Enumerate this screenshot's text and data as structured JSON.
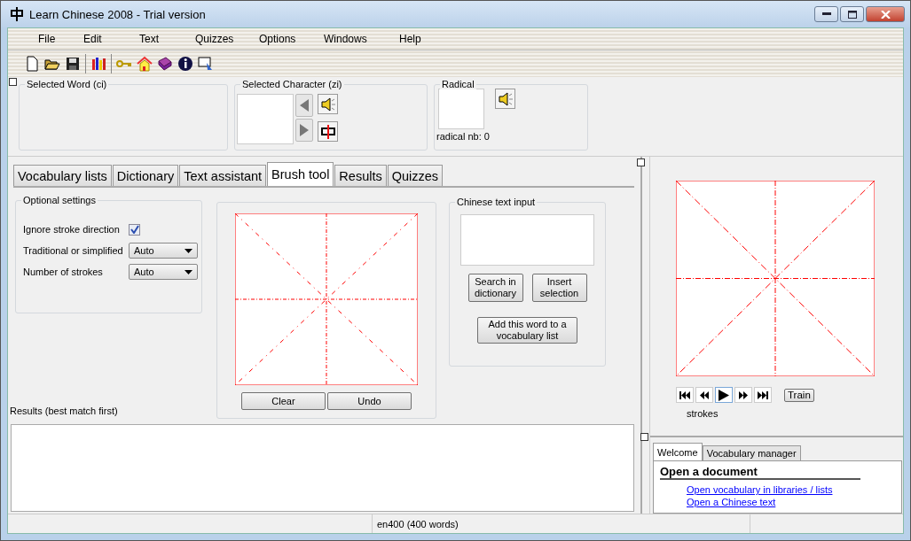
{
  "window": {
    "title": "Learn Chinese 2008 - Trial version"
  },
  "menu": [
    "File",
    "Edit",
    "Text",
    "Quizzes",
    "Options",
    "Windows",
    "Help"
  ],
  "info_panel": {
    "word_title": "Selected Word (ci)",
    "character_title": "Selected Character (zi)",
    "radical_title": "Radical",
    "radical_caption": "radical nb: 0"
  },
  "tabs": [
    {
      "label": "Vocabulary lists",
      "selected": false
    },
    {
      "label": "Dictionary",
      "selected": false
    },
    {
      "label": "Text assistant",
      "selected": false
    },
    {
      "label": "Brush tool",
      "selected": true
    },
    {
      "label": "Results",
      "selected": false
    },
    {
      "label": "Quizzes",
      "selected": false
    }
  ],
  "optional_settings": {
    "title": "Optional settings",
    "ignore_stroke_direction": {
      "label": "Ignore stroke direction",
      "checked": true
    },
    "script": {
      "label": "Traditional or simplified",
      "value": "Auto"
    },
    "strokes": {
      "label": "Number of strokes",
      "value": "Auto"
    }
  },
  "brush_buttons": [
    "Clear",
    "Undo"
  ],
  "text_input": {
    "title": "Chinese text input",
    "search_button": "Search in dictionary",
    "insert_button": "Insert selection",
    "add_button": "Add this word to a vocabulary list"
  },
  "results_label": "Results (best match first)",
  "player": {
    "train_button": "Train",
    "caption": "strokes"
  },
  "bottom_tabs": [
    {
      "label": "Welcome",
      "selected": true
    },
    {
      "label": "Vocabulary manager",
      "selected": false
    }
  ],
  "welcome": {
    "heading": "Open a document",
    "links": [
      "Open vocabulary in libraries / lists",
      "Open a Chinese text"
    ]
  },
  "status_bar": {
    "text": "en400 (400 words)"
  }
}
